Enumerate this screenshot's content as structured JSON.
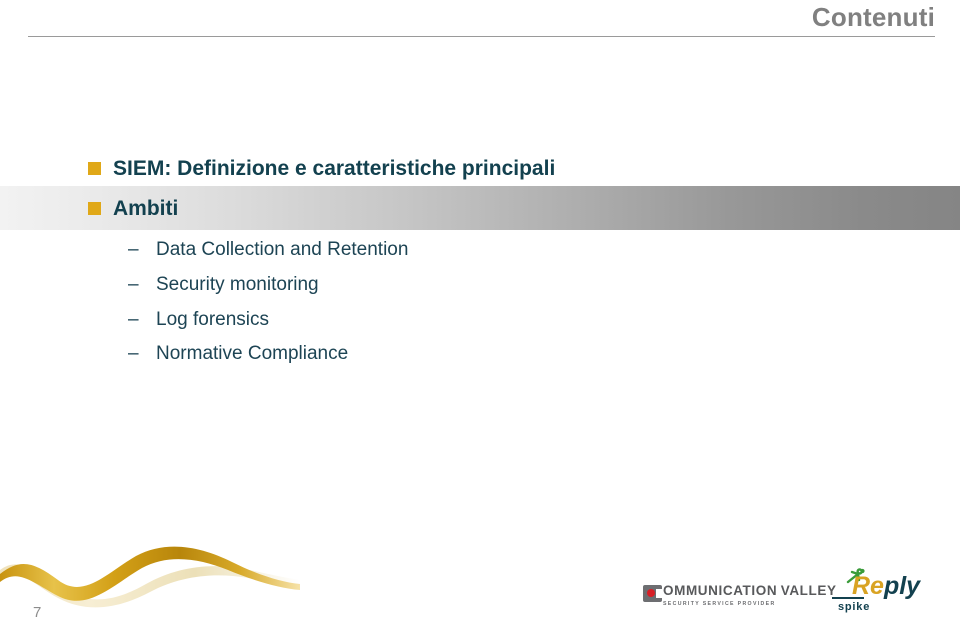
{
  "slide": {
    "title": "Contenuti",
    "page_number": "7"
  },
  "colors": {
    "title_gray": "#808080",
    "bullet_marker": "#e0a818",
    "bullet_text": "#13414f",
    "sub_bullet_text": "#1d4454",
    "band_light": "#f2f2f2",
    "band_dark": "#858585",
    "wave_gold": "#d4a017",
    "wave_cream": "#f0e6c8",
    "logo_red": "#d81f26",
    "logo_gray": "#58595b",
    "reply_gold": "#d9a323",
    "reply_navy": "#13414f",
    "reply_green": "#3a9b3a"
  },
  "bullets": [
    {
      "marker": "square-bullet",
      "label": "SIEM: Definizione e caratteristiche principali"
    },
    {
      "marker": "square-bullet",
      "label": "Ambiti"
    }
  ],
  "sub_bullets": [
    {
      "marker": "–",
      "label": "Data Collection and Retention"
    },
    {
      "marker": "–",
      "label": "Security monitoring"
    },
    {
      "marker": "–",
      "label": "Log forensics"
    },
    {
      "marker": "–",
      "label": "Normative Compliance"
    }
  ],
  "logos": {
    "communication_valley": {
      "name_lead": "C",
      "name_rest": "OMMUNICATION",
      "name_second_lead": "V",
      "name_second_rest": "ALLEY",
      "tagline": "SECURITY SERVICE PROVIDER"
    },
    "reply": {
      "word_first": "Re",
      "word_second": "ply",
      "sub": "spike"
    }
  }
}
